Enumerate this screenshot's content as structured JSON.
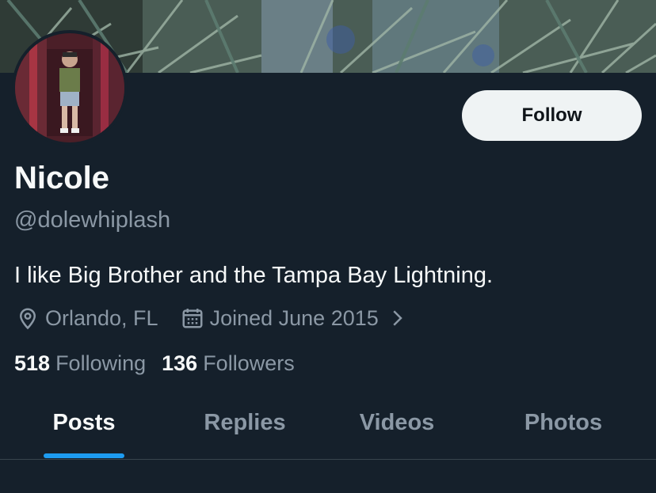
{
  "profile": {
    "name": "Nicole",
    "handle": "@dolewhiplash",
    "bio": "I like Big Brother and the Tampa Bay Lightning.",
    "location": "Orlando, FL",
    "joined": "Joined June 2015",
    "following_count": "518",
    "following_label": "Following",
    "followers_count": "136",
    "followers_label": "Followers"
  },
  "actions": {
    "follow_label": "Follow"
  },
  "tabs": [
    {
      "label": "Posts",
      "active": true
    },
    {
      "label": "Replies",
      "active": false
    },
    {
      "label": "Videos",
      "active": false
    },
    {
      "label": "Photos",
      "active": false
    }
  ],
  "icons": {
    "location": "location-pin-icon",
    "calendar": "calendar-icon",
    "chevron": "chevron-right-icon"
  },
  "colors": {
    "background": "#15202b",
    "accent": "#1d9bf0",
    "primary_text": "#f7f9f9",
    "secondary_text": "#8b98a5",
    "button_bg": "#eff3f4"
  }
}
